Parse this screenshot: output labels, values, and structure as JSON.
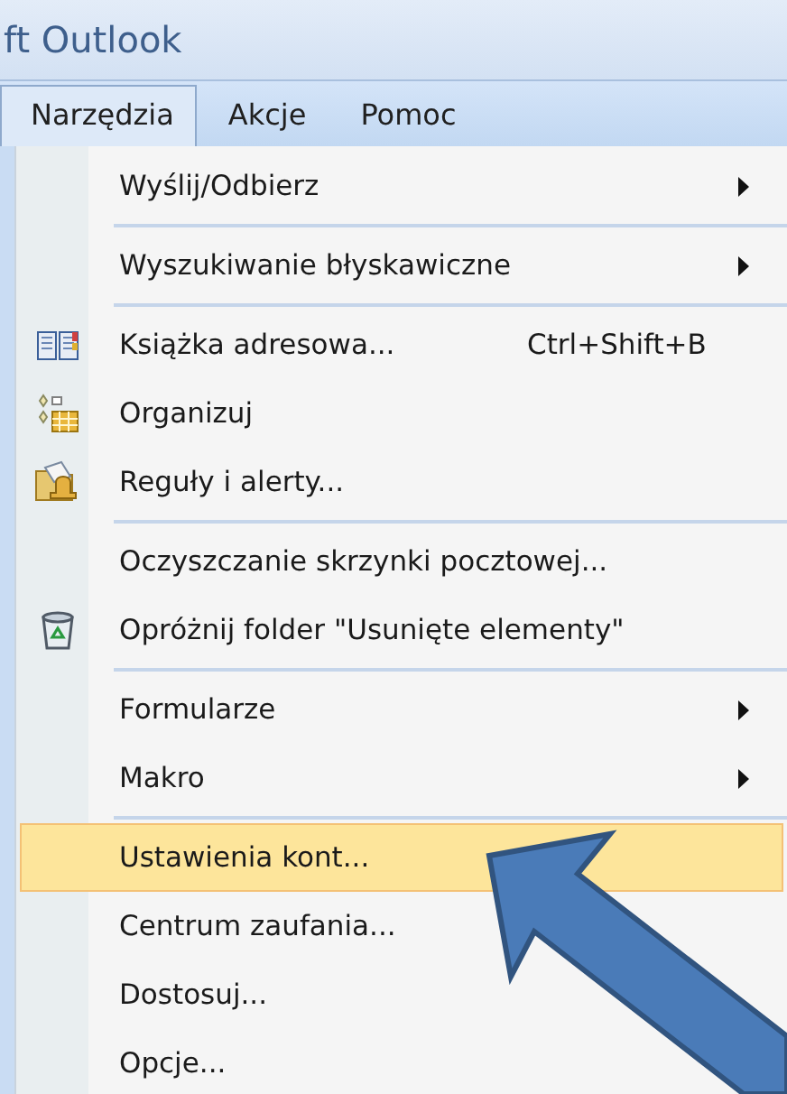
{
  "window": {
    "title": "ft Outlook"
  },
  "menubar": [
    {
      "label": "Narzędzia",
      "selected": true
    },
    {
      "label": "Akcje",
      "selected": false
    },
    {
      "label": "Pomoc",
      "selected": false
    }
  ],
  "menu": [
    {
      "kind": "item",
      "label": "Wyślij/Odbierz",
      "submenu": true,
      "selected": false
    },
    {
      "kind": "separator"
    },
    {
      "kind": "item",
      "label": "Wyszukiwanie błyskawiczne",
      "submenu": true,
      "selected": false
    },
    {
      "kind": "separator"
    },
    {
      "kind": "item",
      "label": "Książka adresowa...",
      "shortcut": "Ctrl+Shift+B",
      "icon": true,
      "submenu": false,
      "selected": false
    },
    {
      "kind": "item",
      "label": "Organizuj",
      "icon": true,
      "submenu": false,
      "selected": false
    },
    {
      "kind": "item",
      "label": "Reguły i alerty...",
      "icon": true,
      "submenu": false,
      "selected": false
    },
    {
      "kind": "separator"
    },
    {
      "kind": "item",
      "label": "Oczyszczanie skrzynki pocztowej...",
      "submenu": false,
      "selected": false
    },
    {
      "kind": "item",
      "label": "Opróżnij folder \"Usunięte elementy\"",
      "icon": true,
      "submenu": false,
      "selected": false
    },
    {
      "kind": "separator"
    },
    {
      "kind": "item",
      "label": "Formularze",
      "submenu": true,
      "selected": false
    },
    {
      "kind": "item",
      "label": "Makro",
      "submenu": true,
      "selected": false
    },
    {
      "kind": "separator"
    },
    {
      "kind": "item",
      "label": "Ustawienia kont...",
      "submenu": false,
      "selected": true
    },
    {
      "kind": "item",
      "label": "Centrum zaufania...",
      "submenu": false,
      "selected": false
    },
    {
      "kind": "item",
      "label": "Dostosuj...",
      "submenu": false,
      "selected": false
    },
    {
      "kind": "item",
      "label": "Opcje...",
      "submenu": false,
      "selected": false
    }
  ]
}
